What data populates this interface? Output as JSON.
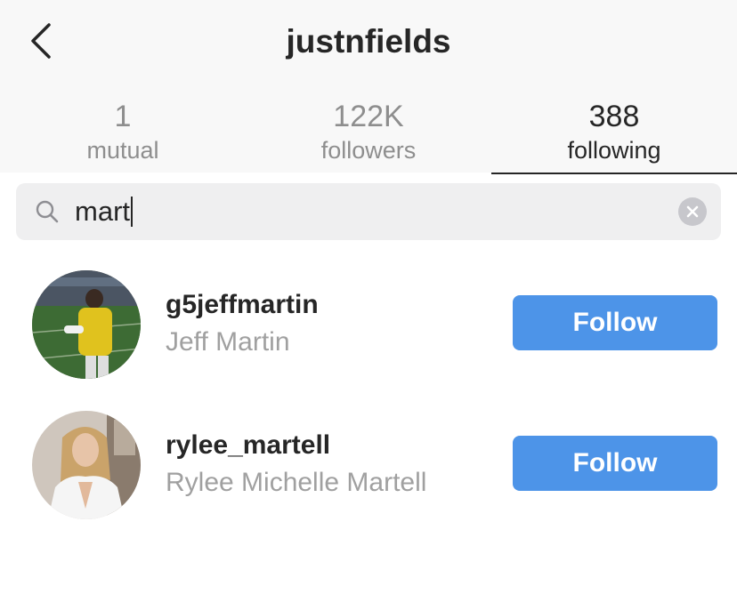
{
  "header": {
    "title": "justnfields",
    "back_icon": "chevron-left-icon"
  },
  "tabs": [
    {
      "count": "1",
      "label": "mutual",
      "active": false
    },
    {
      "count": "122K",
      "label": "followers",
      "active": false
    },
    {
      "count": "388",
      "label": "following",
      "active": true
    }
  ],
  "search": {
    "value": "mart",
    "icon": "search-icon",
    "clear_icon": "clear-icon"
  },
  "results": [
    {
      "username": "g5jeffmartin",
      "full_name": "Jeff Martin",
      "button_label": "Follow"
    },
    {
      "username": "rylee_martell",
      "full_name": "Rylee Michelle Martell",
      "button_label": "Follow"
    }
  ],
  "colors": {
    "accent": "#4d94e8",
    "header_bg": "#f8f8f8",
    "search_bg": "#efeff0",
    "text_primary": "#262626",
    "text_secondary": "#8e8e8e"
  }
}
